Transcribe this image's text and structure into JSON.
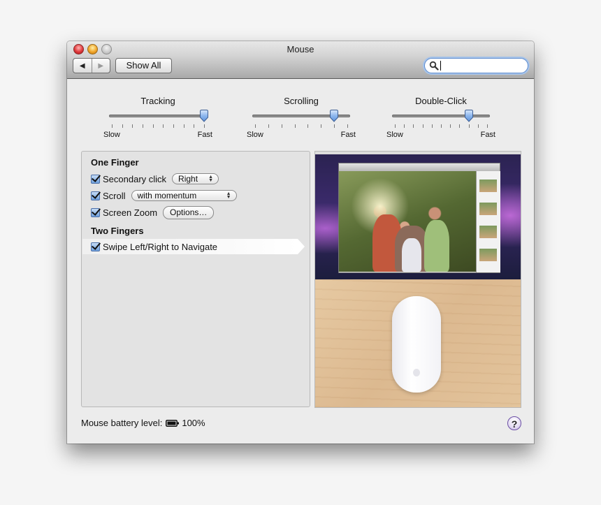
{
  "window": {
    "title": "Mouse",
    "traffic_lights": [
      "close",
      "minimize",
      "zoom"
    ]
  },
  "toolbar": {
    "back_icon": "back-arrow-icon",
    "forward_icon": "forward-arrow-icon",
    "back_glyph": "◀",
    "forward_glyph": "▶",
    "show_all_label": "Show All",
    "search": {
      "value": "",
      "placeholder": "",
      "icon": "magnifier-icon"
    }
  },
  "sliders": [
    {
      "id": "tracking",
      "title": "Tracking",
      "min_label": "Slow",
      "max_label": "Fast",
      "tick_count": 10,
      "value_index": 9
    },
    {
      "id": "scrolling",
      "title": "Scrolling",
      "min_label": "Slow",
      "max_label": "Fast",
      "tick_count": 8,
      "value_index": 6
    },
    {
      "id": "double-click",
      "title": "Double-Click",
      "min_label": "Slow",
      "max_label": "Fast",
      "tick_count": 11,
      "value_index": 8
    }
  ],
  "options": {
    "one_finger_heading": "One Finger",
    "two_fingers_heading": "Two Fingers",
    "secondary_click": {
      "label": "Secondary click",
      "checked": true,
      "popup_value": "Right"
    },
    "scroll": {
      "label": "Scroll",
      "checked": true,
      "popup_value": "with momentum"
    },
    "screen_zoom": {
      "label": "Screen Zoom",
      "checked": true,
      "button_label": "Options…"
    },
    "swipe": {
      "label": "Swipe Left/Right to Navigate",
      "checked": true,
      "selected": true
    }
  },
  "preview": {
    "description": "Demo video: desktop screen with photo app above a Magic Mouse on a wooden desk"
  },
  "footer": {
    "battery_label": "Mouse battery level:",
    "battery_value": "100%",
    "battery_icon": "battery-full-icon",
    "help_label": "?"
  }
}
